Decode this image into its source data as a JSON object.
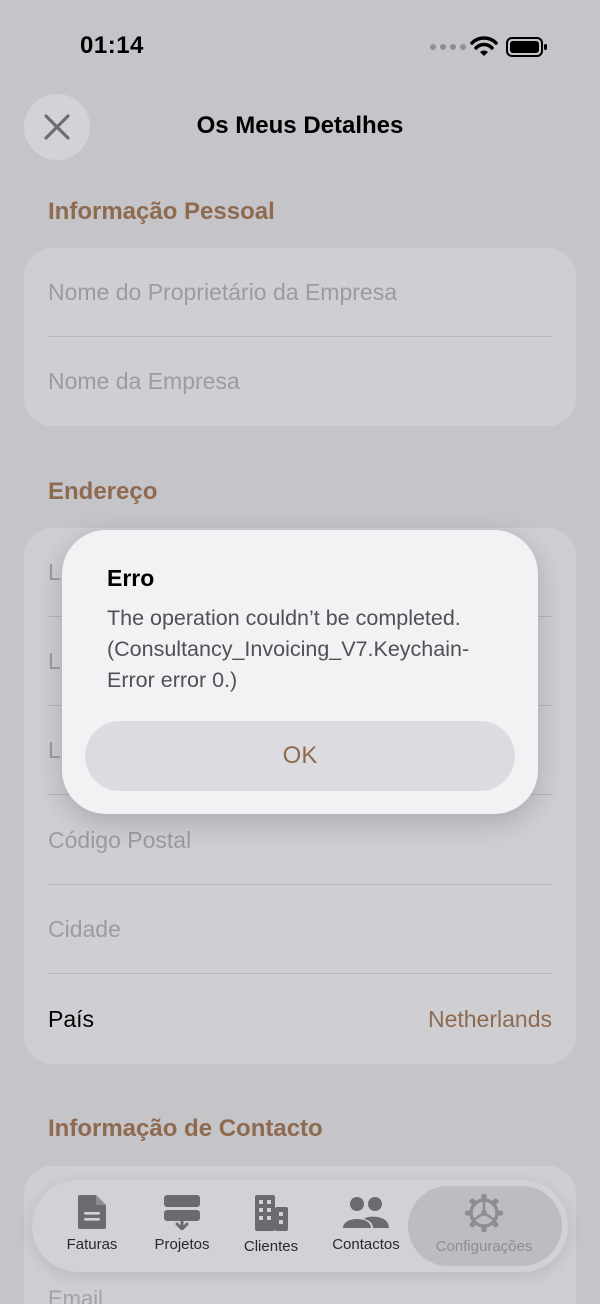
{
  "status_bar": {
    "time": "01:14"
  },
  "nav": {
    "title": "Os Meus Detalhes"
  },
  "sections": {
    "personal": {
      "header": "Informação Pessoal",
      "fields": [
        {
          "placeholder": "Nome do Proprietário da Empresa"
        },
        {
          "placeholder": "Nome da Empresa"
        }
      ]
    },
    "address": {
      "header": "Endereço",
      "partial_fields": [
        "L",
        "L",
        "L"
      ],
      "fields": [
        {
          "placeholder": "Código Postal"
        },
        {
          "placeholder": "Cidade"
        }
      ],
      "country": {
        "label": "País",
        "value": "Netherlands"
      }
    },
    "contact": {
      "header": "Informação de Contacto",
      "peek_field": "Email"
    }
  },
  "dialog": {
    "title": "Erro",
    "message": "The operation couldn’t be completed. (Consultancy_Invoicing_V7.Keychain-Error error 0.)",
    "button_label": "OK"
  },
  "tab_bar": {
    "items": [
      {
        "label": "Faturas",
        "icon": "document-icon"
      },
      {
        "label": "Projetos",
        "icon": "projects-icon"
      },
      {
        "label": "Clientes",
        "icon": "building-icon"
      },
      {
        "label": "Contactos",
        "icon": "people-icon"
      },
      {
        "label": "Configurações",
        "icon": "gear-icon",
        "selected": true
      }
    ]
  },
  "colors": {
    "accent": "#8e6a4f",
    "backdrop": "#c5c4c9",
    "card": "#cfced3",
    "dialog": "#f2f2f4"
  }
}
